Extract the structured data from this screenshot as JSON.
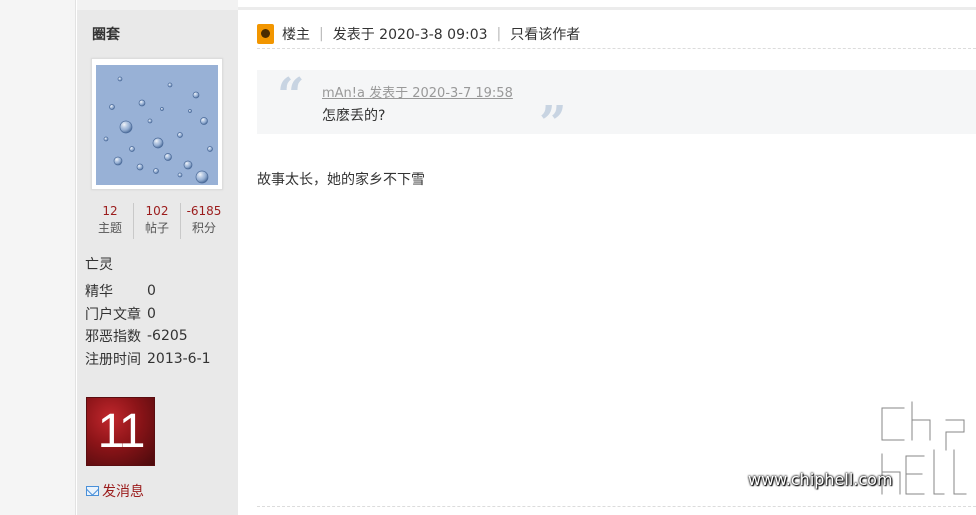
{
  "sidebar": {
    "username": "圈套",
    "stats": [
      {
        "value": "12",
        "label": "主题"
      },
      {
        "value": "102",
        "label": "帖子"
      },
      {
        "value": "-6185",
        "label": "积分"
      }
    ],
    "user_group": "亡灵",
    "info": [
      {
        "key": "精华",
        "value": "0"
      },
      {
        "key": "门户文章",
        "value": "0"
      },
      {
        "key": "邪恶指数",
        "value": "-6205"
      },
      {
        "key": "注册时间",
        "value": "2013-6-1"
      }
    ],
    "medal_text": "11",
    "send_message": "发消息"
  },
  "post": {
    "op_label": "楼主",
    "posted_at": "发表于 2020-3-8 09:03",
    "only_author": "只看该作者",
    "quote": {
      "meta": "mAn!a 发表于 2020-3-7 19:58",
      "text": "怎麽丢的?"
    },
    "body": "故事太长，她的家乡不下雪"
  },
  "watermark": {
    "url": "www.chiphell.com"
  },
  "colors": {
    "accent_red": "#9b1c1c",
    "op_badge": "#f29600",
    "quote_bg": "#f5f6f7"
  }
}
